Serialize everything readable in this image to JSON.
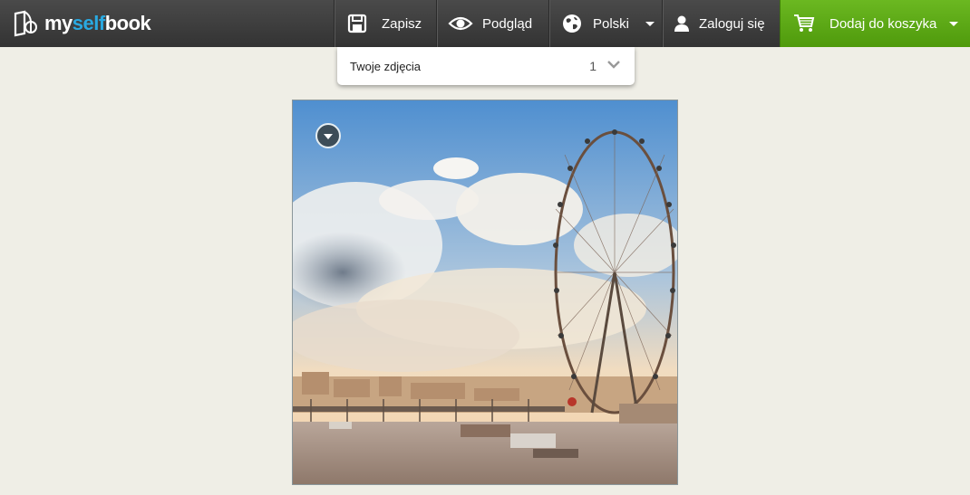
{
  "brand": {
    "seg1": "my",
    "seg2": "self",
    "seg3": "book",
    "accent": "#29a9e1"
  },
  "nav": {
    "save": {
      "label": "Zapisz",
      "icon": "floppy-disk-icon"
    },
    "preview": {
      "label": "Podgląd",
      "icon": "eye-icon"
    },
    "language": {
      "label": "Polski",
      "icon": "globe-icon"
    },
    "login": {
      "label": "Zaloguj się",
      "icon": "user-icon"
    },
    "cart": {
      "label": "Dodaj do koszyka",
      "icon": "shopping-cart-icon",
      "color": "#5ea817"
    }
  },
  "photos_panel": {
    "label": "Twoje zdjęcia",
    "count": "1",
    "icon": "chevron-down-icon"
  },
  "photo": {
    "subject": "London Eye by the Thames",
    "menu_icon": "caret-down-icon"
  }
}
